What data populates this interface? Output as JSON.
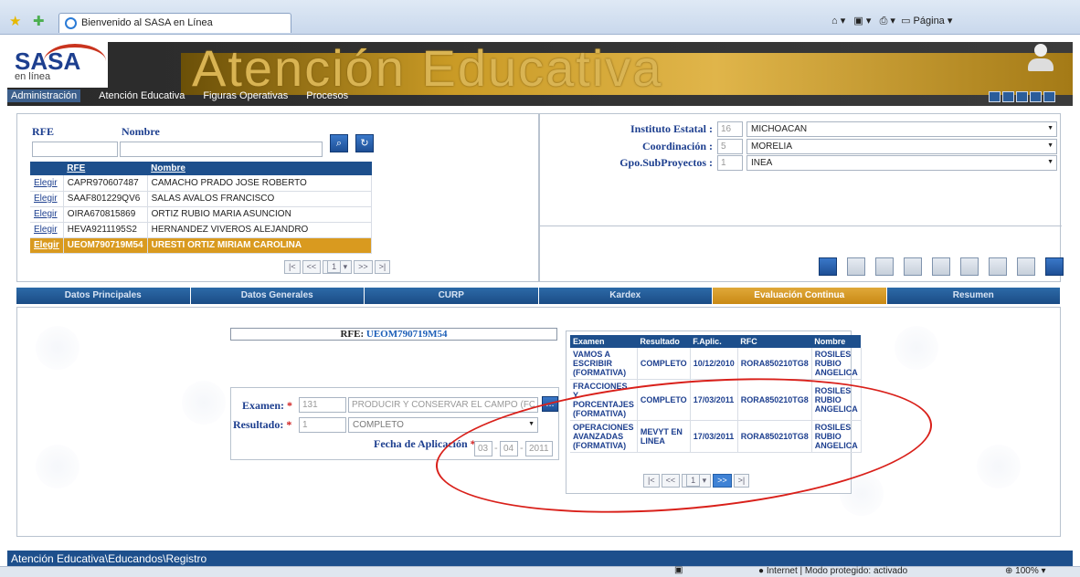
{
  "browser": {
    "tab_title": "Bienvenido al SASA en Línea",
    "page_menu": "Página",
    "status_text": "Internet | Modo protegido: activado",
    "zoom": "100%"
  },
  "header": {
    "logo_text": "SASA",
    "logo_subtext": "en línea",
    "title": "Atención Educativa",
    "menu": [
      "Administración",
      "Atención Educativa",
      "Figuras Operativas",
      "Procesos"
    ]
  },
  "search": {
    "rfe_label": "RFE",
    "nombre_label": "Nombre",
    "rfe_value": "",
    "nombre_value": ""
  },
  "educandos": {
    "headers": [
      "RFE",
      "Nombre"
    ],
    "choose_label": "Elegir",
    "rows": [
      {
        "rfe": "CAPR970607487",
        "nombre": "CAMACHO PRADO JOSE ROBERTO"
      },
      {
        "rfe": "SAAF801229QV6",
        "nombre": "SALAS AVALOS FRANCISCO"
      },
      {
        "rfe": "OIRA670815869",
        "nombre": "ORTIZ RUBIO MARIA ASUNCION"
      },
      {
        "rfe": "HEVA9211195S2",
        "nombre": "HERNANDEZ VIVEROS ALEJANDRO"
      },
      {
        "rfe": "UEOM790719M54",
        "nombre": "URESTI ORTIZ MIRIAM CAROLINA"
      }
    ],
    "pager": {
      "first": "|<",
      "prev": "<<",
      "page": "1",
      "next": ">>",
      "last": ">|"
    }
  },
  "context": {
    "instituto_label": "Instituto Estatal :",
    "instituto_code": "16",
    "instituto_value": "MICHOACAN",
    "coordinacion_label": "Coordinación :",
    "coordinacion_code": "5",
    "coordinacion_value": "MORELIA",
    "gpo_label": "Gpo.SubProyectos :",
    "gpo_code": "1",
    "gpo_value": "INEA"
  },
  "tabs": [
    "Datos Principales",
    "Datos Generales",
    "CURP",
    "Kardex",
    "Evaluación Continua",
    "Resumen"
  ],
  "evaluation": {
    "rfe_label": "RFE:",
    "rfe_value": "UEOM790719M54",
    "examen_label": "Examen:",
    "examen_code": "131",
    "examen_name": "PRODUCIR Y CONSERVAR EL CAMPO (FORMATIVA)",
    "resultado_label": "Resultado:",
    "resultado_code": "1",
    "resultado_value": "COMPLETO",
    "fecha_label": "Fecha de Aplicación",
    "fecha_day": "03",
    "fecha_month": "04",
    "fecha_year": "2011",
    "required_mark": "*",
    "lookup_label": "..."
  },
  "results": {
    "headers": [
      "Examen",
      "Resultado",
      "F.Aplic.",
      "RFC",
      "Nombre"
    ],
    "rows": [
      {
        "examen": "VAMOS A ESCRIBIR (FORMATIVA)",
        "resultado": "COMPLETO",
        "fecha": "10/12/2010",
        "rfc": "RORA850210TG8",
        "nombre": "ROSILES RUBIO ANGELICA"
      },
      {
        "examen": "FRACCIONES Y PORCENTAJES (FORMATIVA)",
        "resultado": "COMPLETO",
        "fecha": "17/03/2011",
        "rfc": "RORA850210TG8",
        "nombre": "ROSILES RUBIO ANGELICA"
      },
      {
        "examen": "OPERACIONES AVANZADAS (FORMATIVA)",
        "resultado": "MEVYT EN LINEA",
        "fecha": "17/03/2011",
        "rfc": "RORA850210TG8",
        "nombre": "ROSILES RUBIO ANGELICA"
      }
    ],
    "pager": {
      "first": "|<",
      "prev": "<<",
      "page": "1",
      "next": ">>",
      "last": ">|"
    }
  },
  "footer": {
    "breadcrumb": "Atención Educativa\\Educandos\\Registro"
  }
}
